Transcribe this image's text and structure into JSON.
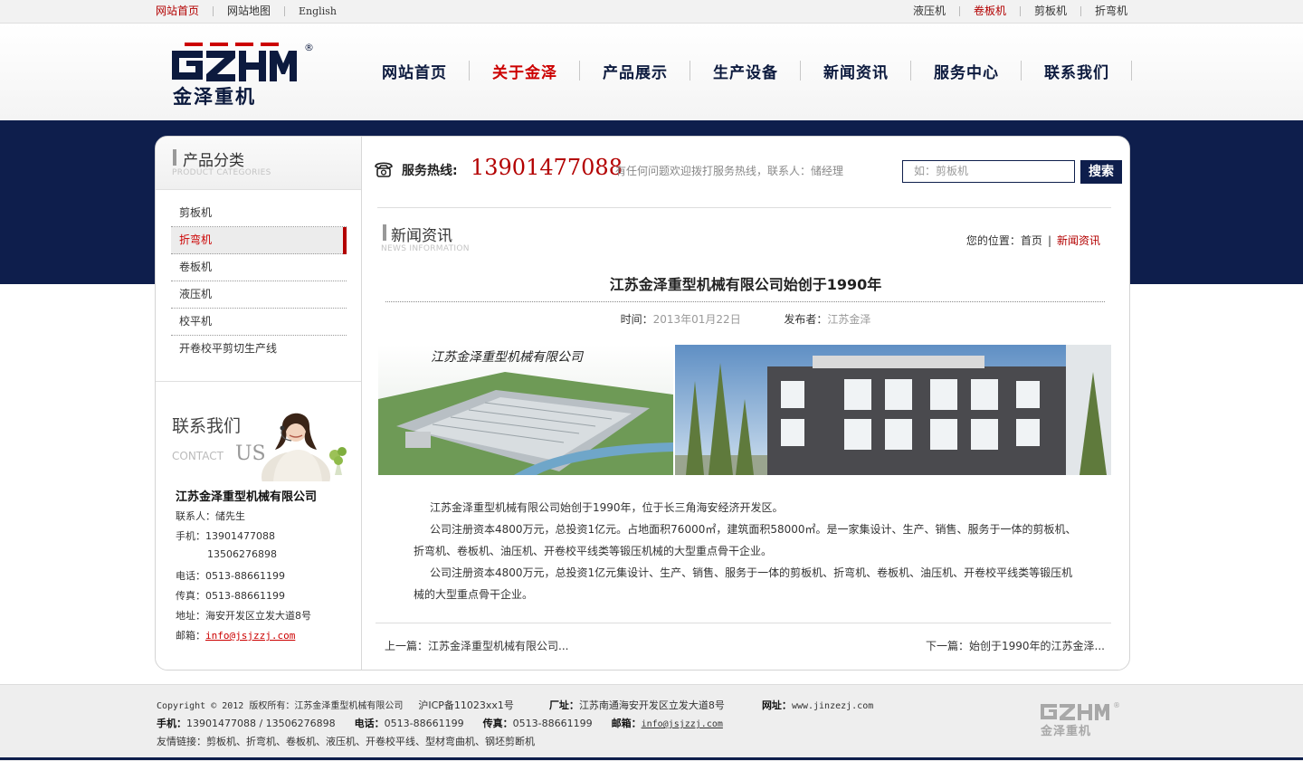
{
  "topbar": {
    "left": [
      "网站首页",
      "网站地图",
      "English"
    ],
    "right": [
      "液压机",
      "卷板机",
      "剪板机",
      "折弯机"
    ]
  },
  "logo": {
    "mark": "GZHM",
    "name": "金泽重机",
    "reg": "®"
  },
  "nav": [
    "网站首页",
    "关于金泽",
    "产品展示",
    "生产设备",
    "新闻资讯",
    "服务中心",
    "联系我们"
  ],
  "sidebar": {
    "title": "产品分类",
    "subtitle": "PRODUCT CATEGORIES",
    "items": [
      "剪板机",
      "折弯机",
      "卷板机",
      "液压机",
      "校平机",
      "开卷校平剪切生产线"
    ]
  },
  "contact": {
    "title_cn": "联系我们",
    "title_en_a": "CONTACT",
    "title_en_b": "US",
    "company": "江苏金泽重型机械有限公司",
    "person": "联系人：储先生",
    "mobile1": "手机：13901477088",
    "mobile2": "13506276898",
    "tel": "电话：0513-88661199",
    "fax": "传真：0513-88661199",
    "address": "地址：海安开发区立发大道8号",
    "email_label": "邮箱：",
    "email": "info@jsjzzj.com"
  },
  "hotline": {
    "label": "服务热线:",
    "number": "13901477088",
    "note": "有任何问题欢迎拨打服务热线，联系人：储经理"
  },
  "search": {
    "placeholder": "如：剪板机",
    "button": "搜索"
  },
  "section": {
    "title": "新闻资讯",
    "subtitle": "NEWS INFORMATION",
    "crumb_prefix": "您的位置：",
    "crumb_home": "首页",
    "crumb_sep": "|",
    "crumb_current": "新闻资讯"
  },
  "article": {
    "title": "江苏金泽重型机械有限公司始创于1990年",
    "time_label": "时间：",
    "time": "2013年01月22日",
    "publisher_label": "发布者：",
    "publisher": "江苏金泽",
    "image_caption": "江苏金泽重型机械有限公司",
    "paragraphs": [
      "江苏金泽重型机械有限公司始创于1990年，位于长三角海安经济开发区。",
      "公司注册资本4800万元，总投资1亿元。占地面积76000㎡，建筑面积58000㎡。是一家集设计、生产、销售、服务于一体的剪板机、折弯机、卷板机、油压机、开卷校平线类等锻压机械的大型重点骨干企业。",
      "公司注册资本4800万元，总投资1亿元集设计、生产、销售、服务于一体的剪板机、折弯机、卷板机、油压机、开卷校平线类等锻压机械的大型重点骨干企业。"
    ],
    "prev": "上一篇：江苏金泽重型机械有限公司...",
    "next": "下一篇：始创于1990年的江苏金泽..."
  },
  "footer": {
    "copyright": "Copyright © 2012 版权所有：江苏金泽重型机械有限公司",
    "icp": "沪ICP备11023xx1号",
    "factory_label": "厂址：",
    "factory": "江苏南通海安开发区立发大道8号",
    "site_label": "网址：",
    "site": "www.jinzezj.com",
    "mobile_label": "手机：",
    "mobile": "13901477088 / 13506276898",
    "tel_label": "电话：",
    "tel": "0513-88661199",
    "fax_label": "传真：",
    "fax": "0513-88661199",
    "email_label": "邮箱：",
    "email": "info@jsjzzj.com",
    "links": "友情链接：剪板机、折弯机、卷板机、液压机、开卷校平线、型材弯曲机、钢坯剪断机"
  },
  "colors": {
    "navy": "#0e1e4c",
    "red": "#b30000"
  }
}
